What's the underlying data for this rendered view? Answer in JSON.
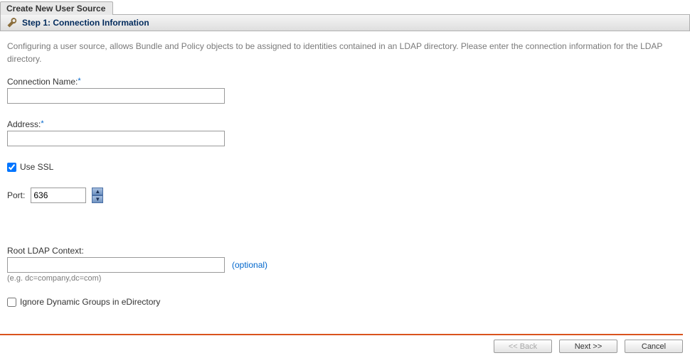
{
  "tab": {
    "title": "Create New User Source"
  },
  "step": {
    "title": "Step 1: Connection Information"
  },
  "intro": "Configuring a user source, allows Bundle and Policy objects to be assigned to identities contained in an LDAP directory. Please enter the connection information for the LDAP directory.",
  "fields": {
    "connectionName": {
      "label": "Connection Name:",
      "value": ""
    },
    "address": {
      "label": "Address:",
      "value": ""
    },
    "useSSL": {
      "label": "Use SSL",
      "checked": true
    },
    "port": {
      "label": "Port:",
      "value": "636"
    },
    "rootContext": {
      "label": "Root LDAP Context:",
      "value": "",
      "optional": "(optional)",
      "hint": "(e.g. dc=company,dc=com)"
    },
    "ignoreDynamic": {
      "label": "Ignore Dynamic Groups in eDirectory",
      "checked": false
    }
  },
  "buttons": {
    "back": "<< Back",
    "next": "Next >>",
    "cancel": "Cancel"
  }
}
